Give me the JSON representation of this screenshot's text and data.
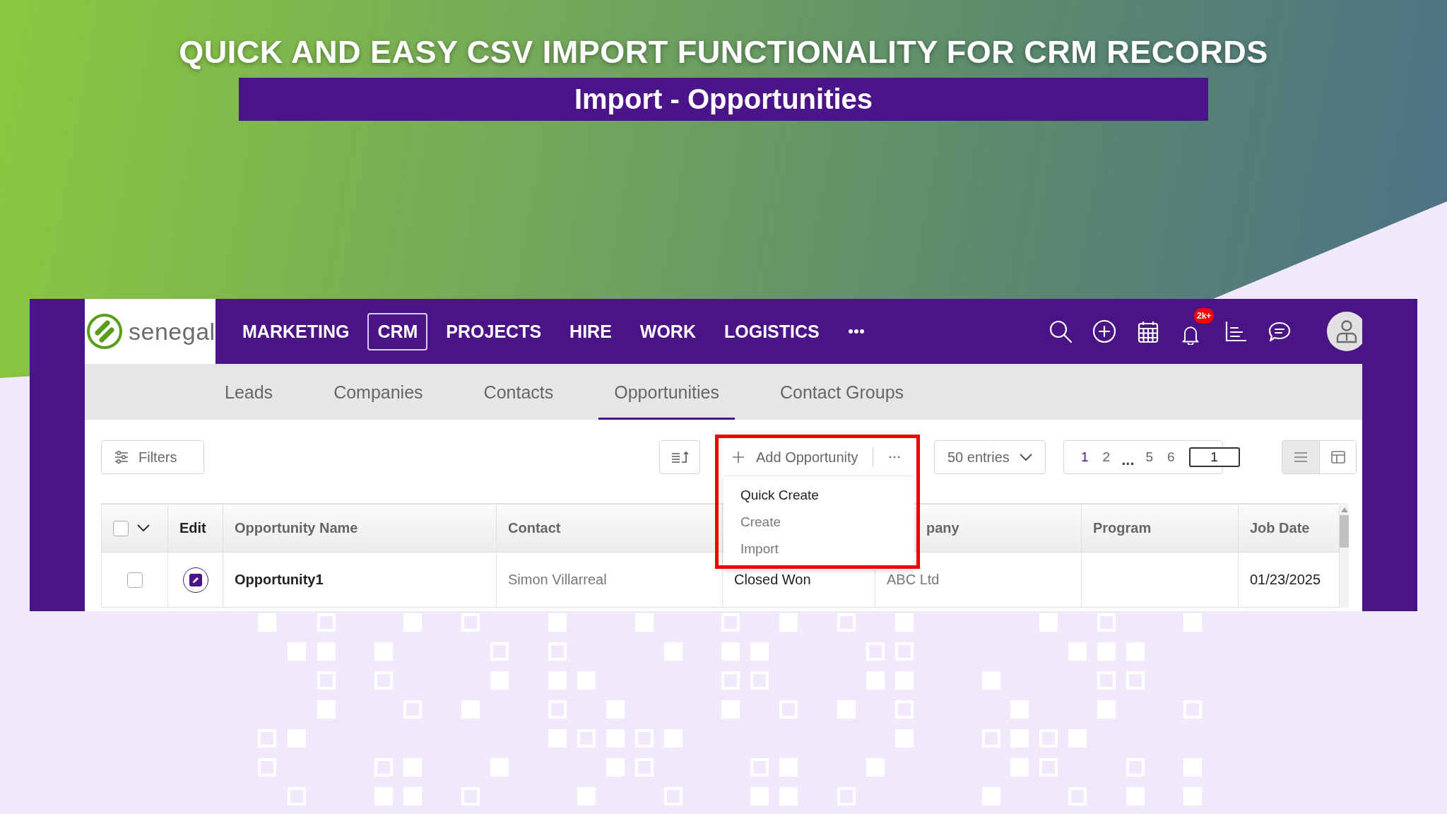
{
  "headline": {
    "title": "QUICK AND EASY CSV IMPORT FUNCTIONALITY FOR CRM RECORDS",
    "subtitle": "Import - Opportunities"
  },
  "app": {
    "brand": "senegal",
    "nav": [
      {
        "label": "MARKETING",
        "selected": false
      },
      {
        "label": "CRM",
        "selected": true
      },
      {
        "label": "PROJECTS",
        "selected": false
      },
      {
        "label": "HIRE",
        "selected": false
      },
      {
        "label": "WORK",
        "selected": false
      },
      {
        "label": "LOGISTICS",
        "selected": false
      }
    ],
    "notification_badge": "2k+",
    "tabs": [
      {
        "label": "Leads",
        "selected": false
      },
      {
        "label": "Companies",
        "selected": false
      },
      {
        "label": "Contacts",
        "selected": false
      },
      {
        "label": "Opportunities",
        "selected": true
      },
      {
        "label": "Contact Groups",
        "selected": false
      }
    ],
    "toolbar": {
      "filters": "Filters",
      "add_button": "Add Opportunity",
      "entries": "50 entries",
      "pages": [
        {
          "label": "1",
          "selected": true
        },
        {
          "label": "2",
          "selected": false
        },
        {
          "label": "...",
          "kind": "gap"
        },
        {
          "label": "5",
          "selected": false
        },
        {
          "label": "6",
          "selected": false
        }
      ],
      "page_input": "1",
      "views": [
        {
          "kind": "list",
          "selected": true
        },
        {
          "kind": "board",
          "selected": false
        }
      ]
    },
    "add_menu": {
      "expanded": true,
      "items": [
        {
          "label": "Quick Create",
          "selected": true
        },
        {
          "label": "Create",
          "selected": false
        },
        {
          "label": "Import",
          "selected": false
        }
      ]
    },
    "table": {
      "select_all": {
        "checked": false
      },
      "columns": [
        {
          "kind": "edit",
          "label": "Edit"
        },
        {
          "kind": "text",
          "label": "Opportunity Name"
        },
        {
          "kind": "text",
          "label": "Contact"
        },
        {
          "kind": "text"
        },
        {
          "kind": "text",
          "label": "pany"
        },
        {
          "kind": "text",
          "label": "Program"
        },
        {
          "kind": "text",
          "label": "Job Date"
        }
      ],
      "rows": [
        {
          "checked": false,
          "cells": [
            "",
            "Opportunity1",
            "Simon Villarreal",
            "Closed Won",
            "ABC Ltd",
            null,
            "01/23/2025"
          ]
        }
      ]
    }
  }
}
